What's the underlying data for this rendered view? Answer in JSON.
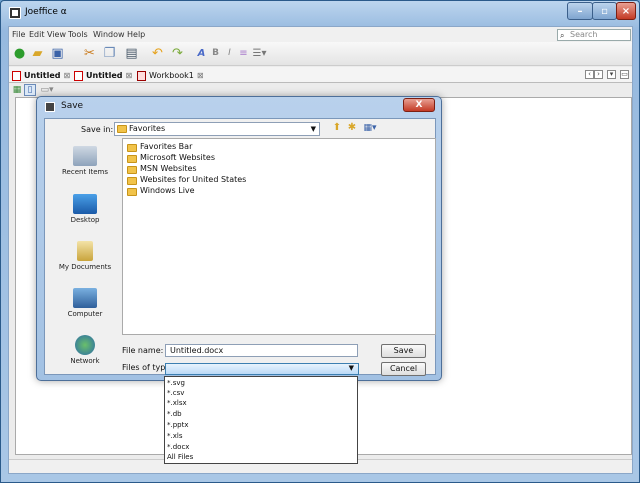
{
  "window": {
    "title": "Joeffice α"
  },
  "menubar": {
    "items": [
      "File",
      "Edit",
      "View",
      "Tools",
      "Window",
      "Help"
    ],
    "search_placeholder": "Search"
  },
  "toolbar": {
    "icons": [
      "new-icon",
      "open-icon",
      "save-icon",
      "cut-icon",
      "copy-icon",
      "paste-icon",
      "undo-icon",
      "redo-icon",
      "italic-a-icon",
      "bold-icon",
      "italic-icon",
      "align-icon",
      "list-icon"
    ]
  },
  "tabs": [
    {
      "label": "Untitled",
      "close": "⊠"
    },
    {
      "label": "Untitled",
      "close": "⊠"
    },
    {
      "label": "Workbook1",
      "close": "⊠"
    }
  ],
  "dialog": {
    "title": "Save",
    "save_in_label": "Save in:",
    "save_in_value": "Favorites",
    "places": [
      "Recent Items",
      "Desktop",
      "My Documents",
      "Computer",
      "Network"
    ],
    "files": [
      "Favorites Bar",
      "Microsoft Websites",
      "MSN Websites",
      "Websites for United States",
      "Windows Live"
    ],
    "file_name_label": "File name:",
    "file_name_value": "Untitled.docx",
    "files_of_type_label": "Files of type:",
    "save_button": "Save",
    "cancel_button": "Cancel",
    "close_glyph": "X"
  },
  "type_options": [
    "*.svg",
    "*.csv",
    "*.xlsx",
    "*.db",
    "*.pptx",
    "*.xls",
    "*.docx",
    "All Files"
  ]
}
